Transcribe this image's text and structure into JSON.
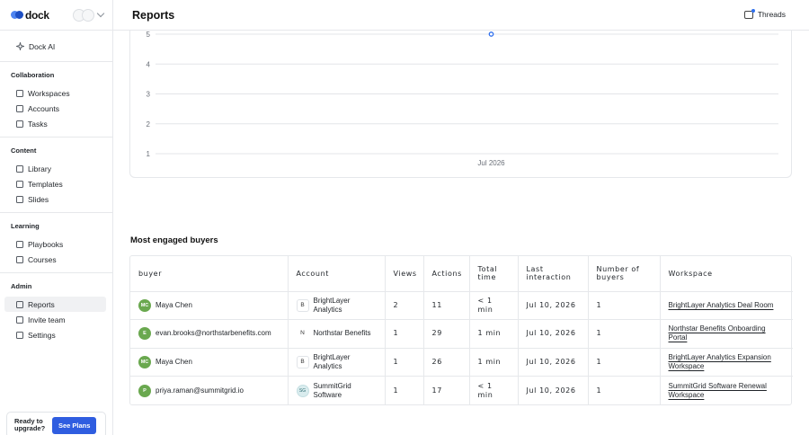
{
  "brand": {
    "name": "dock"
  },
  "header": {
    "title": "Reports",
    "threads_label": "Threads"
  },
  "sidebar": {
    "top_item": {
      "label": "Dock AI",
      "icon": "sparkle-icon"
    },
    "sections": [
      {
        "title": "Collaboration",
        "items": [
          {
            "label": "Workspaces",
            "icon": "grid-icon"
          },
          {
            "label": "Accounts",
            "icon": "building-icon"
          },
          {
            "label": "Tasks",
            "icon": "checklist-icon"
          }
        ]
      },
      {
        "title": "Content",
        "items": [
          {
            "label": "Library",
            "icon": "library-icon"
          },
          {
            "label": "Templates",
            "icon": "template-icon"
          },
          {
            "label": "Slides",
            "icon": "slides-icon"
          }
        ]
      },
      {
        "title": "Learning",
        "items": [
          {
            "label": "Playbooks",
            "icon": "playbook-icon"
          },
          {
            "label": "Courses",
            "icon": "book-icon"
          }
        ]
      },
      {
        "title": "Admin",
        "items": [
          {
            "label": "Reports",
            "icon": "reports-icon",
            "active": true
          },
          {
            "label": "Invite team",
            "icon": "invite-icon"
          },
          {
            "label": "Settings",
            "icon": "settings-icon"
          }
        ]
      }
    ],
    "upgrade": {
      "text": "Ready to upgrade?",
      "button": "See Plans"
    }
  },
  "chart_data": {
    "type": "line",
    "x": [
      "Jul 2026"
    ],
    "series": [
      {
        "values": [
          5
        ]
      }
    ],
    "y_ticks": [
      1,
      2,
      3,
      4,
      5
    ],
    "ylim": [
      1,
      5
    ],
    "x_tick_labels": [
      "Jul 2026"
    ],
    "grid": true,
    "color": "#2f6fed"
  },
  "buyers": {
    "title": "Most engaged buyers",
    "columns": [
      "buyer",
      "Account",
      "Views",
      "Actions",
      "Total time",
      "Last interaction",
      "Number of buyers",
      "Workspace"
    ],
    "rows": [
      {
        "initials": "MC",
        "avatar_color": "#6aa84f",
        "buyer": "Maya Chen",
        "badge": "B",
        "badge_style": "square",
        "account": "BrightLayer Analytics",
        "views": "2",
        "actions": "11",
        "time": "< 1 min",
        "last": "Jul 10, 2026",
        "buyers": "1",
        "workspace": "BrightLayer Analytics Deal Room"
      },
      {
        "initials": "E",
        "avatar_color": "#6aa84f",
        "buyer": "evan.brooks@northstarbenefits.com",
        "badge": "N",
        "badge_style": "plain",
        "account": "Northstar Benefits",
        "views": "1",
        "actions": "29",
        "time": "1 min",
        "last": "Jul 10, 2026",
        "buyers": "1",
        "workspace": "Northstar Benefits Onboarding Portal"
      },
      {
        "initials": "MC",
        "avatar_color": "#6aa84f",
        "buyer": "Maya Chen",
        "badge": "B",
        "badge_style": "square",
        "account": "BrightLayer Analytics",
        "views": "1",
        "actions": "26",
        "time": "1 min",
        "last": "Jul 10, 2026",
        "buyers": "1",
        "workspace": "BrightLayer Analytics Expansion Workspace"
      },
      {
        "initials": "P",
        "avatar_color": "#6aa84f",
        "buyer": "priya.raman@summitgrid.io",
        "badge": "SG",
        "badge_style": "round",
        "account": "SummitGrid Software",
        "views": "1",
        "actions": "17",
        "time": "< 1 min",
        "last": "Jul 10, 2026",
        "buyers": "1",
        "workspace": "SummitGrid Software Renewal Workspace"
      }
    ]
  }
}
